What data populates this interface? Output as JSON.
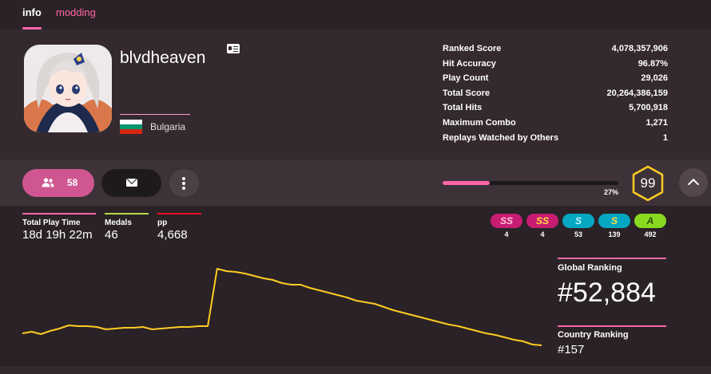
{
  "tabs": {
    "info": "info",
    "modding": "modding"
  },
  "user": {
    "username": "blvdheaven",
    "country": "Bulgaria"
  },
  "stats": [
    {
      "label": "Ranked Score",
      "value": "4,078,357,906"
    },
    {
      "label": "Hit Accuracy",
      "value": "96.87%"
    },
    {
      "label": "Play Count",
      "value": "29,026"
    },
    {
      "label": "Total Score",
      "value": "20,264,386,159"
    },
    {
      "label": "Total Hits",
      "value": "5,700,918"
    },
    {
      "label": "Maximum Combo",
      "value": "1,271"
    },
    {
      "label": "Replays Watched by Others",
      "value": "1"
    }
  ],
  "actions": {
    "friends_count": "58"
  },
  "level": {
    "progress_label": "27%",
    "progress": 0.27,
    "level": "99"
  },
  "profile_stats": [
    {
      "label": "Total Play Time",
      "value": "18d 19h 22m",
      "color": "#ff66aa"
    },
    {
      "label": "Medals",
      "value": "46",
      "color": "#b3d944"
    },
    {
      "label": "pp",
      "value": "4,668",
      "color": "#ed1121"
    }
  ],
  "grades": [
    {
      "grade": "SS",
      "count": "4",
      "bg": "#c61c72",
      "fg": "#ffc4d6",
      "silver": true
    },
    {
      "grade": "SS",
      "count": "4",
      "bg": "#c61c72",
      "fg": "#ffdf3d",
      "silver": false
    },
    {
      "grade": "S",
      "count": "53",
      "bg": "#05a7c2",
      "fg": "#c6f6ff",
      "silver": true
    },
    {
      "grade": "S",
      "count": "139",
      "bg": "#05a7c2",
      "fg": "#ffdf3d",
      "silver": false
    },
    {
      "grade": "A",
      "count": "492",
      "bg": "#88da20",
      "fg": "#2a4d00",
      "silver": false
    }
  ],
  "ranking": {
    "global_label": "Global Ranking",
    "global_value": "#52,884",
    "country_label": "Country Ranking",
    "country_value": "#157"
  },
  "rank_history": {
    "points": [
      0.17,
      0.19,
      0.16,
      0.2,
      0.23,
      0.27,
      0.26,
      0.26,
      0.25,
      0.22,
      0.23,
      0.24,
      0.24,
      0.25,
      0.22,
      0.23,
      0.24,
      0.25,
      0.25,
      0.26,
      0.26,
      0.98,
      0.95,
      0.94,
      0.92,
      0.89,
      0.86,
      0.84,
      0.8,
      0.78,
      0.78,
      0.74,
      0.71,
      0.68,
      0.65,
      0.62,
      0.58,
      0.56,
      0.54,
      0.5,
      0.46,
      0.43,
      0.4,
      0.37,
      0.34,
      0.31,
      0.28,
      0.26,
      0.23,
      0.2,
      0.17,
      0.15,
      0.12,
      0.09,
      0.07,
      0.03,
      0.02
    ],
    "color": "#ffcc22"
  },
  "colors": {
    "accent": "#ff66aa",
    "level_badge": "#ffcc22",
    "flag": [
      "#ffffff",
      "#00966e",
      "#d62612"
    ]
  }
}
